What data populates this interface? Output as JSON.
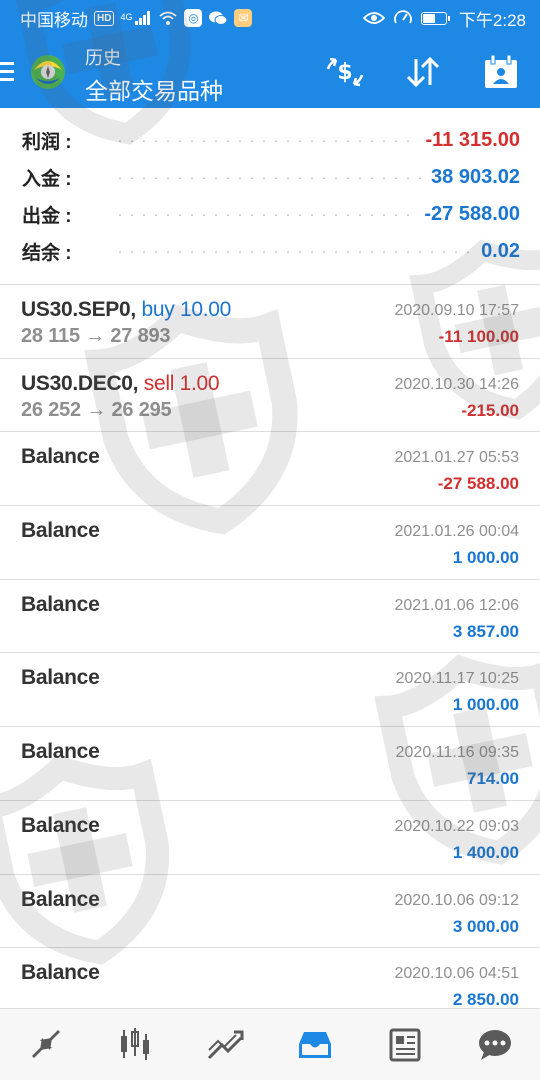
{
  "status_bar": {
    "carrier": "中国移动",
    "hd_badge": "HD",
    "network": "4G",
    "time": "下午2:28",
    "battery_level": 0.55
  },
  "header": {
    "title": "历史",
    "subtitle": "全部交易品种",
    "icons": [
      "menu-icon",
      "app-logo-icon",
      "dollar-exchange-icon",
      "sort-icon",
      "calendar-icon"
    ]
  },
  "summary": [
    {
      "label": "利润 :",
      "value": "-11 315.00",
      "tone": "neg"
    },
    {
      "label": "入金 :",
      "value": "38 903.02",
      "tone": "pos"
    },
    {
      "label": "出金 :",
      "value": "-27 588.00",
      "tone": "pos"
    },
    {
      "label": "结余 :",
      "value": "0.02",
      "tone": "pos"
    }
  ],
  "trades": [
    {
      "symbol": "US30.SEP0,",
      "side": "buy 10.00",
      "side_tone": "buy",
      "prices": "28 115 → 27 893",
      "date": "2020.09.10 17:57",
      "profit": "-11 100.00",
      "tone": "neg"
    },
    {
      "symbol": "US30.DEC0,",
      "side": "sell 1.00",
      "side_tone": "sell",
      "prices": "26 252 → 26 295",
      "date": "2020.10.30 14:26",
      "profit": "-215.00",
      "tone": "neg"
    },
    {
      "symbol": "Balance",
      "side": "",
      "side_tone": "",
      "prices": "",
      "date": "2021.01.27 05:53",
      "profit": "-27 588.00",
      "tone": "neg"
    },
    {
      "symbol": "Balance",
      "side": "",
      "side_tone": "",
      "prices": "",
      "date": "2021.01.26 00:04",
      "profit": "1 000.00",
      "tone": "pos"
    },
    {
      "symbol": "Balance",
      "side": "",
      "side_tone": "",
      "prices": "",
      "date": "2021.01.06 12:06",
      "profit": "3 857.00",
      "tone": "pos"
    },
    {
      "symbol": "Balance",
      "side": "",
      "side_tone": "",
      "prices": "",
      "date": "2020.11.17 10:25",
      "profit": "1 000.00",
      "tone": "pos"
    },
    {
      "symbol": "Balance",
      "side": "",
      "side_tone": "",
      "prices": "",
      "date": "2020.11.16 09:35",
      "profit": "714.00",
      "tone": "pos"
    },
    {
      "symbol": "Balance",
      "side": "",
      "side_tone": "",
      "prices": "",
      "date": "2020.10.22 09:03",
      "profit": "1 400.00",
      "tone": "pos"
    },
    {
      "symbol": "Balance",
      "side": "",
      "side_tone": "",
      "prices": "",
      "date": "2020.10.06 09:12",
      "profit": "3 000.00",
      "tone": "pos"
    },
    {
      "symbol": "Balance",
      "side": "",
      "side_tone": "",
      "prices": "",
      "date": "2020.10.06 04:51",
      "profit": "2 850.00",
      "tone": "pos"
    }
  ],
  "bottom_nav": [
    {
      "name": "quotes",
      "icon": "trade-arrows-icon",
      "active": false
    },
    {
      "name": "chart",
      "icon": "candlestick-icon",
      "active": false
    },
    {
      "name": "trade",
      "icon": "trend-icon",
      "active": false
    },
    {
      "name": "history",
      "icon": "inbox-icon",
      "active": true
    },
    {
      "name": "news",
      "icon": "newspaper-icon",
      "active": false
    },
    {
      "name": "messages",
      "icon": "chat-icon",
      "active": false
    }
  ],
  "colors": {
    "primary": "#1e88e5",
    "negative": "#d32f2f",
    "positive": "#1976d2",
    "muted": "#8f8f8f",
    "nav_icon": "#5a5a5a",
    "nav_active": "#1e88e5"
  }
}
